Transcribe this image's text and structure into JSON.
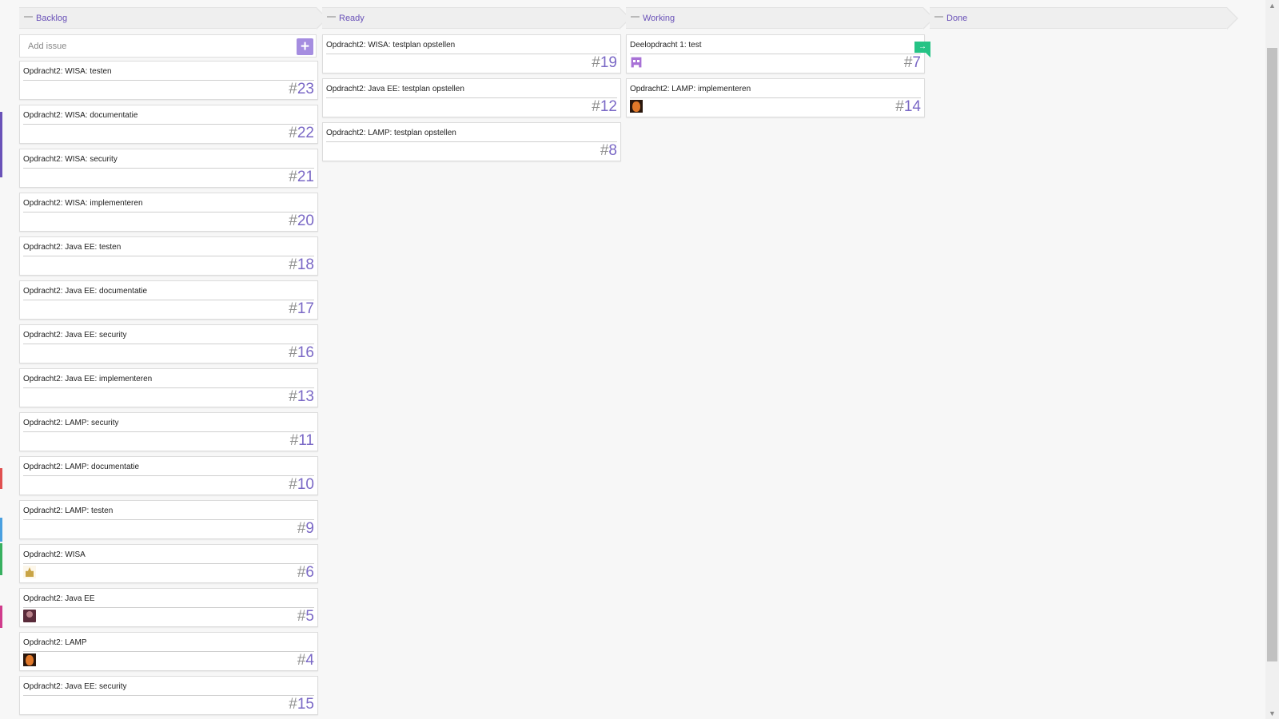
{
  "accent_color": "#7a68c6",
  "add_issue": {
    "placeholder": "Add issue",
    "button_icon": "plus-icon",
    "button_glyph": "+"
  },
  "columns": [
    {
      "title": "Backlog",
      "cards": [
        {
          "title": "Opdracht2: WISA: testen",
          "hash": "#",
          "number": "23"
        },
        {
          "title": "Opdracht2: WISA: documentatie",
          "hash": "#",
          "number": "22"
        },
        {
          "title": "Opdracht2: WISA: security",
          "hash": "#",
          "number": "21"
        },
        {
          "title": "Opdracht2: WISA: implementeren",
          "hash": "#",
          "number": "20"
        },
        {
          "title": "Opdracht2: Java EE: testen",
          "hash": "#",
          "number": "18"
        },
        {
          "title": "Opdracht2: Java EE: documentatie",
          "hash": "#",
          "number": "17"
        },
        {
          "title": "Opdracht2: Java EE: security",
          "hash": "#",
          "number": "16"
        },
        {
          "title": "Opdracht2: Java EE: implementeren",
          "hash": "#",
          "number": "13"
        },
        {
          "title": "Opdracht2: LAMP: security",
          "hash": "#",
          "number": "11"
        },
        {
          "title": "Opdracht2: LAMP: documentatie",
          "hash": "#",
          "number": "10"
        },
        {
          "title": "Opdracht2: LAMP: testen",
          "hash": "#",
          "number": "9"
        },
        {
          "title": "Opdracht2: WISA",
          "hash": "#",
          "number": "6",
          "avatar": "trophy-avatar-icon"
        },
        {
          "title": "Opdracht2: Java EE",
          "hash": "#",
          "number": "5",
          "avatar": "person-avatar-icon"
        },
        {
          "title": "Opdracht2: LAMP",
          "hash": "#",
          "number": "4",
          "avatar": "face-avatar-icon"
        },
        {
          "title": "Opdracht2: Java EE: security",
          "hash": "#",
          "number": "15"
        }
      ]
    },
    {
      "title": "Ready",
      "cards": [
        {
          "title": "Opdracht2: WISA: testplan opstellen",
          "hash": "#",
          "number": "19"
        },
        {
          "title": "Opdracht2: Java EE: testplan opstellen",
          "hash": "#",
          "number": "12"
        },
        {
          "title": "Opdracht2: LAMP: testplan opstellen",
          "hash": "#",
          "number": "8"
        }
      ]
    },
    {
      "title": "Working",
      "cards": [
        {
          "title": "Deelopdracht 1: test",
          "hash": "#",
          "number": "7",
          "avatar": "pixel-avatar-icon",
          "flag": "→"
        },
        {
          "title": "Opdracht2: LAMP: implementeren",
          "hash": "#",
          "number": "14",
          "avatar": "face-avatar-icon"
        }
      ]
    },
    {
      "title": "Done",
      "cards": []
    }
  ],
  "edge_strips": [
    {
      "color": "#6a52b8"
    },
    {
      "color": "#e05050"
    },
    {
      "color": "#4aa0e0"
    },
    {
      "color": "#38b060"
    },
    {
      "color": "#d03c8c"
    }
  ],
  "scrollbar": {
    "up_glyph": "▲",
    "down_glyph": "▼"
  }
}
